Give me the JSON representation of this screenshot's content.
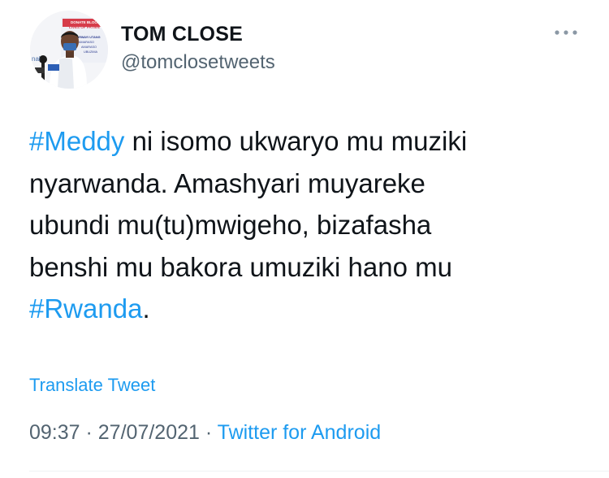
{
  "author": {
    "display_name": "TOM CLOSE",
    "handle": "@tomclosetweets",
    "avatar_icon": "profile-photo",
    "avatar_banner_lines": [
      "DONATE BLOOD",
      "LIVES OF PATIEN",
      "ABARWAYI UTANG",
      "AMARASO",
      "AMARASO",
      "UBUZIMA"
    ],
    "avatar_side_text": "nal"
  },
  "more_icon": "ellipsis-icon",
  "tweet": {
    "line1_hashtag": "#Meddy",
    "line1_rest": " ni isomo ukwaryo mu muziki",
    "line2": "nyarwanda. Amashyari muyareke",
    "line3": "ubundi mu(tu)mwigeho, bizafasha",
    "line4": "benshi mu bakora umuziki hano mu",
    "line5_hashtag": "#Rwanda",
    "line5_rest": "."
  },
  "translate_label": "Translate Tweet",
  "meta": {
    "time": "09:37",
    "separator1": " · ",
    "date": "27/07/2021",
    "separator2": " · ",
    "source": "Twitter for Android"
  },
  "colors": {
    "link": "#1d9bf0",
    "text": "#0f1419",
    "secondary": "#536471"
  }
}
